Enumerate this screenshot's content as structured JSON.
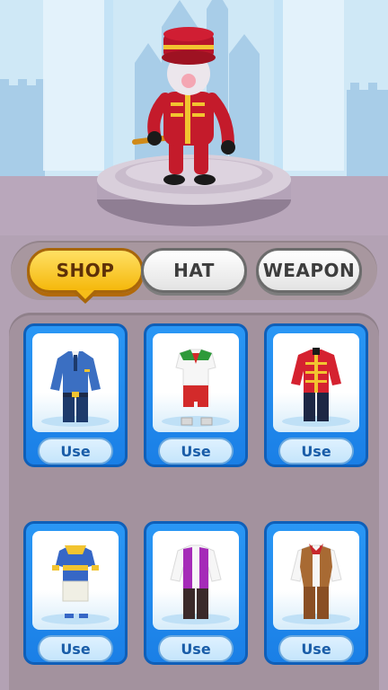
{
  "tabs": [
    {
      "label": "SHOP",
      "active": true
    },
    {
      "label": "HAT",
      "active": false
    },
    {
      "label": "WEAPON",
      "active": false
    }
  ],
  "outfits": [
    {
      "name": "police-uniform",
      "action": "Use"
    },
    {
      "name": "green-white-outfit",
      "action": "Use"
    },
    {
      "name": "red-guard-uniform",
      "action": "Use"
    },
    {
      "name": "sailor-outfit",
      "action": "Use"
    },
    {
      "name": "purple-vest-outfit",
      "action": "Use"
    },
    {
      "name": "cowboy-outfit",
      "action": "Use"
    }
  ],
  "colors": {
    "active_tab": "#f5b80c",
    "card_blue": "#1a7fe6",
    "panel": "#a3929e"
  }
}
